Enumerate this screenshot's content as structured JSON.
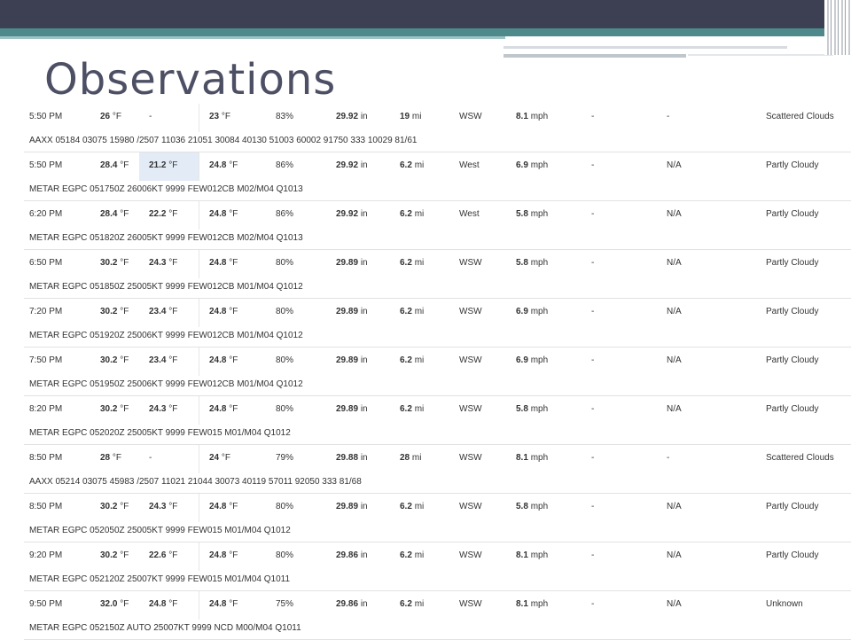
{
  "page": {
    "title": "Observations"
  },
  "observations": [
    {
      "time": "5:50 PM",
      "temp": "26",
      "wind_chill": "-",
      "dew_point": "23",
      "humidity": "83%",
      "pressure": "29.92",
      "visibility": "19",
      "wind_dir": "WSW",
      "wind_speed": "8.1",
      "gust": "-",
      "precip": "-",
      "conditions": "Scattered Clouds",
      "metar": "AAXX 05184 03075 15980 /2507 11036 21051 30084 40130 51003 60002 91750 333 10029 81/61"
    },
    {
      "time": "5:50 PM",
      "temp": "28.4",
      "wind_chill": "21.2",
      "dew_point": "24.8",
      "humidity": "86%",
      "pressure": "29.92",
      "visibility": "6.2",
      "wind_dir": "West",
      "wind_speed": "6.9",
      "gust": "-",
      "precip": "N/A",
      "conditions": "Partly Cloudy",
      "metar": "METAR EGPC 051750Z 26006KT 9999 FEW012CB M02/M04 Q1013"
    },
    {
      "time": "6:20 PM",
      "temp": "28.4",
      "wind_chill": "22.2",
      "dew_point": "24.8",
      "humidity": "86%",
      "pressure": "29.92",
      "visibility": "6.2",
      "wind_dir": "West",
      "wind_speed": "5.8",
      "gust": "-",
      "precip": "N/A",
      "conditions": "Partly Cloudy",
      "metar": "METAR EGPC 051820Z 26005KT 9999 FEW012CB M02/M04 Q1013"
    },
    {
      "time": "6:50 PM",
      "temp": "30.2",
      "wind_chill": "24.3",
      "dew_point": "24.8",
      "humidity": "80%",
      "pressure": "29.89",
      "visibility": "6.2",
      "wind_dir": "WSW",
      "wind_speed": "5.8",
      "gust": "-",
      "precip": "N/A",
      "conditions": "Partly Cloudy",
      "metar": "METAR EGPC 051850Z 25005KT 9999 FEW012CB M01/M04 Q1012"
    },
    {
      "time": "7:20 PM",
      "temp": "30.2",
      "wind_chill": "23.4",
      "dew_point": "24.8",
      "humidity": "80%",
      "pressure": "29.89",
      "visibility": "6.2",
      "wind_dir": "WSW",
      "wind_speed": "6.9",
      "gust": "-",
      "precip": "N/A",
      "conditions": "Partly Cloudy",
      "metar": "METAR EGPC 051920Z 25006KT 9999 FEW012CB M01/M04 Q1012"
    },
    {
      "time": "7:50 PM",
      "temp": "30.2",
      "wind_chill": "23.4",
      "dew_point": "24.8",
      "humidity": "80%",
      "pressure": "29.89",
      "visibility": "6.2",
      "wind_dir": "WSW",
      "wind_speed": "6.9",
      "gust": "-",
      "precip": "N/A",
      "conditions": "Partly Cloudy",
      "metar": "METAR EGPC 051950Z 25006KT 9999 FEW012CB M01/M04 Q1012"
    },
    {
      "time": "8:20 PM",
      "temp": "30.2",
      "wind_chill": "24.3",
      "dew_point": "24.8",
      "humidity": "80%",
      "pressure": "29.89",
      "visibility": "6.2",
      "wind_dir": "WSW",
      "wind_speed": "5.8",
      "gust": "-",
      "precip": "N/A",
      "conditions": "Partly Cloudy",
      "metar": "METAR EGPC 052020Z 25005KT 9999 FEW015 M01/M04 Q1012"
    },
    {
      "time": "8:50 PM",
      "temp": "28",
      "wind_chill": "-",
      "dew_point": "24",
      "humidity": "79%",
      "pressure": "29.88",
      "visibility": "28",
      "wind_dir": "WSW",
      "wind_speed": "8.1",
      "gust": "-",
      "precip": "-",
      "conditions": "Scattered Clouds",
      "metar": "AAXX 05214 03075 45983 /2507 11021 21044 30073 40119 57011 92050 333 81/68"
    },
    {
      "time": "8:50 PM",
      "temp": "30.2",
      "wind_chill": "24.3",
      "dew_point": "24.8",
      "humidity": "80%",
      "pressure": "29.89",
      "visibility": "6.2",
      "wind_dir": "WSW",
      "wind_speed": "5.8",
      "gust": "-",
      "precip": "N/A",
      "conditions": "Partly Cloudy",
      "metar": "METAR EGPC 052050Z 25005KT 9999 FEW015 M01/M04 Q1012"
    },
    {
      "time": "9:20 PM",
      "temp": "30.2",
      "wind_chill": "22.6",
      "dew_point": "24.8",
      "humidity": "80%",
      "pressure": "29.86",
      "visibility": "6.2",
      "wind_dir": "WSW",
      "wind_speed": "8.1",
      "gust": "-",
      "precip": "N/A",
      "conditions": "Partly Cloudy",
      "metar": "METAR EGPC 052120Z 25007KT 9999 FEW015 M01/M04 Q1011"
    },
    {
      "time": "9:50 PM",
      "temp": "32.0",
      "wind_chill": "24.8",
      "dew_point": "24.8",
      "humidity": "75%",
      "pressure": "29.86",
      "visibility": "6.2",
      "wind_dir": "WSW",
      "wind_speed": "8.1",
      "gust": "-",
      "precip": "N/A",
      "conditions": "Unknown",
      "metar": "METAR EGPC 052150Z AUTO 25007KT 9999 NCD M00/M04 Q1011"
    }
  ],
  "units": {
    "temp": "°F",
    "pressure": "in",
    "visibility": "mi",
    "speed": "mph"
  },
  "highlighted_row": 1,
  "colors": {
    "title": "#4d4f64",
    "header_dark": "#3d3f52",
    "header_teal": "#4e8a8c",
    "highlight": "#e3ebf6"
  }
}
